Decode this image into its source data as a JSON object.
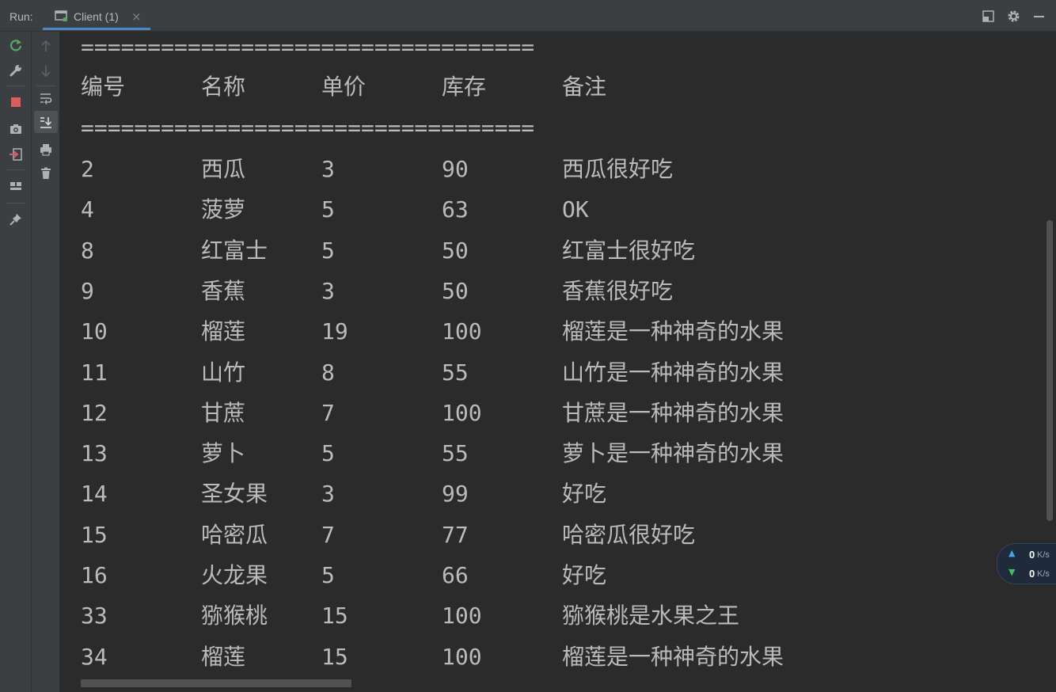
{
  "header": {
    "run_label": "Run:",
    "tab_title": "Client (1)",
    "close_glyph": "×"
  },
  "console": {
    "separator": "==================================",
    "columns": [
      "编号",
      "名称",
      "单价",
      "库存",
      "备注"
    ],
    "rows": [
      [
        "2",
        "西瓜",
        "3",
        "90",
        "西瓜很好吃"
      ],
      [
        "4",
        "菠萝",
        "5",
        "63",
        "OK"
      ],
      [
        "8",
        "红富士",
        "5",
        "50",
        "红富士很好吃"
      ],
      [
        "9",
        "香蕉",
        "3",
        "50",
        "香蕉很好吃"
      ],
      [
        "10",
        "榴莲",
        "19",
        "100",
        "榴莲是一种神奇的水果"
      ],
      [
        "11",
        "山竹",
        "8",
        "55",
        "山竹是一种神奇的水果"
      ],
      [
        "12",
        "甘蔗",
        "7",
        "100",
        "甘蔗是一种神奇的水果"
      ],
      [
        "13",
        "萝卜",
        "5",
        "55",
        "萝卜是一种神奇的水果"
      ],
      [
        "14",
        "圣女果",
        "3",
        "99",
        "好吃"
      ],
      [
        "15",
        "哈密瓜",
        "7",
        "77",
        "哈密瓜很好吃"
      ],
      [
        "16",
        "火龙果",
        "5",
        "66",
        "好吃"
      ],
      [
        "33",
        "猕猴桃",
        "15",
        "100",
        "猕猴桃是水果之王"
      ],
      [
        "34",
        "榴莲",
        "15",
        "100",
        "榴莲是一种神奇的水果"
      ]
    ]
  },
  "net_widget": {
    "upload_value": "0",
    "upload_unit": "K/s",
    "download_value": "0",
    "download_unit": "K/s"
  },
  "icons": {
    "rerun": "rerun-icon",
    "wrench": "wrench-icon",
    "stop": "stop-icon",
    "camera": "camera-icon",
    "exit": "exit-icon",
    "layout": "layout-icon",
    "pin": "pin-icon",
    "up": "arrow-up-icon",
    "down": "arrow-down-icon",
    "wrap": "soft-wrap-icon",
    "scroll_end": "scroll-to-end-icon",
    "print": "print-icon",
    "trash": "trash-icon",
    "minimize": "minimize-icon",
    "settings": "gear-icon",
    "restore": "restore-layout-icon"
  },
  "colors": {
    "rerun": "#59a869",
    "stop": "#db5c5c",
    "exit": "#db5c5c",
    "tab_underline": "#4a88c7",
    "console_text": "#bbbbbb"
  }
}
